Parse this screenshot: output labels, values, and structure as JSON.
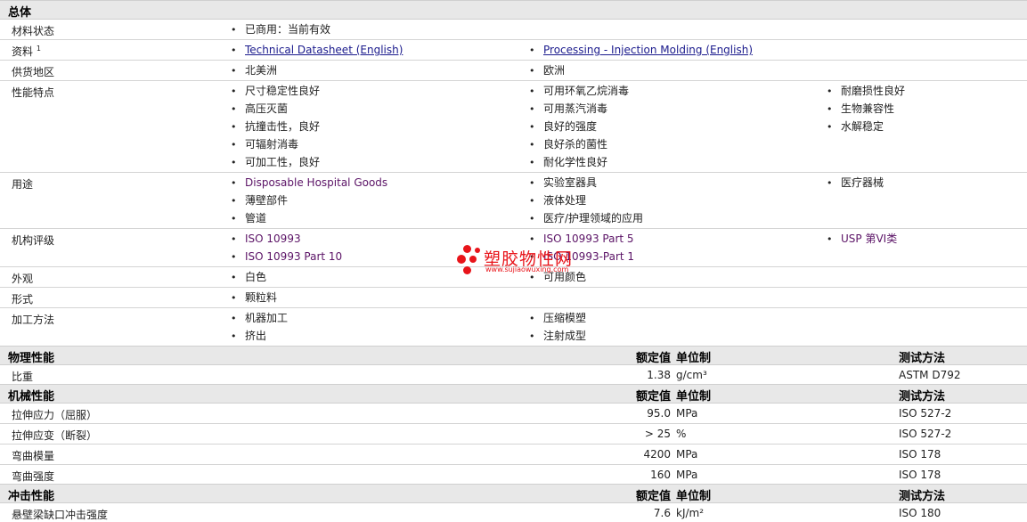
{
  "general": {
    "title": "总体",
    "rows": [
      {
        "label": "材料状态",
        "cols": [
          [
            "已商用：当前有效"
          ]
        ]
      },
      {
        "label": "资料",
        "sup": "1",
        "cols": [
          [
            "Technical Datasheet (English)"
          ],
          [
            "Processing - Injection Molding (English)"
          ]
        ]
      },
      {
        "label": "供货地区",
        "cols": [
          [
            "北美洲"
          ],
          [
            "欧洲"
          ]
        ]
      },
      {
        "label": "性能特点",
        "cols": [
          [
            "尺寸稳定性良好",
            "高压灭菌",
            "抗撞击性，良好",
            "可辐射消毒",
            "可加工性，良好"
          ],
          [
            "可用环氧乙烷消毒",
            "可用蒸汽消毒",
            "良好的强度",
            "良好杀的菌性",
            "耐化学性良好"
          ],
          [
            "耐磨损性良好",
            "生物兼容性",
            "水解稳定"
          ]
        ]
      },
      {
        "label": "用途",
        "cols": [
          [
            "Disposable Hospital Goods",
            "薄壁部件",
            "管道"
          ],
          [
            "实验室器具",
            "液体处理",
            "医疗/护理领域的应用"
          ],
          [
            "医疗器械"
          ]
        ]
      },
      {
        "label": "机构评级",
        "cols": [
          [
            "ISO 10993",
            "ISO 10993 Part 10"
          ],
          [
            "ISO 10993 Part 5",
            "ISO 10993-Part 1"
          ],
          [
            "USP 第VI类"
          ]
        ]
      },
      {
        "label": "外观",
        "cols": [
          [
            "白色"
          ],
          [
            "可用颜色"
          ]
        ]
      },
      {
        "label": "形式",
        "cols": [
          [
            "颗粒料"
          ]
        ]
      },
      {
        "label": "加工方法",
        "cols": [
          [
            "机器加工",
            "挤出"
          ],
          [
            "压缩模塑",
            "注射成型"
          ]
        ]
      }
    ]
  },
  "column_headers": {
    "nominal": "额定值",
    "unit": "单位制",
    "method": "测试方法"
  },
  "property_sections": [
    {
      "title": "物理性能",
      "rows": [
        {
          "label": "比重",
          "value": "1.38",
          "unit": "g/cm³",
          "method": "ASTM D792"
        }
      ]
    },
    {
      "title": "机械性能",
      "rows": [
        {
          "label": "拉伸应力（屈服）",
          "value": "95.0",
          "unit": "MPa",
          "method": "ISO 527-2"
        },
        {
          "label": "拉伸应变（断裂）",
          "value": "> 25",
          "unit": "%",
          "method": "ISO 527-2"
        },
        {
          "label": "弯曲模量",
          "value": "4200",
          "unit": "MPa",
          "method": "ISO 178"
        },
        {
          "label": "弯曲强度",
          "value": "160",
          "unit": "MPa",
          "method": "ISO 178"
        }
      ]
    },
    {
      "title": "冲击性能",
      "rows": [
        {
          "label": "悬壁梁缺口冲击强度",
          "value": "7.6",
          "unit": "kJ/m²",
          "method": "ISO 180"
        }
      ]
    }
  ],
  "watermark": {
    "name": "塑胶物性网",
    "url": "www.sujiaowuxing.com",
    "color": "#e8141a"
  }
}
